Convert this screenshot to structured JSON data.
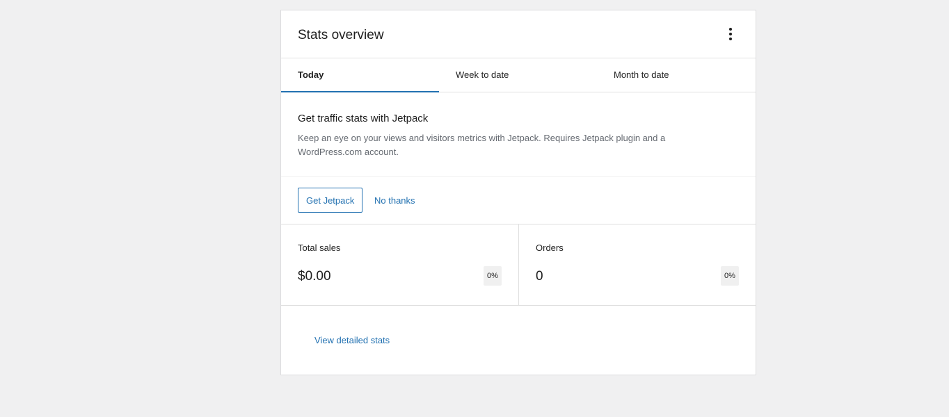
{
  "card": {
    "title": "Stats overview",
    "menu_icon": "more-vertical-icon"
  },
  "tabs": [
    {
      "label": "Today",
      "active": true
    },
    {
      "label": "Week to date",
      "active": false
    },
    {
      "label": "Month to date",
      "active": false
    }
  ],
  "promo": {
    "title": "Get traffic stats with Jetpack",
    "description": "Keep an eye on your views and visitors metrics with Jetpack. Requires Jetpack plugin and a WordPress.com account.",
    "primary_label": "Get Jetpack",
    "secondary_label": "No thanks"
  },
  "stats": [
    {
      "label": "Total sales",
      "value": "$0.00",
      "delta": "0%"
    },
    {
      "label": "Orders",
      "value": "0",
      "delta": "0%"
    }
  ],
  "footer": {
    "link_label": "View detailed stats"
  },
  "colors": {
    "accent": "#2271b1",
    "background": "#f0f0f1",
    "card": "#ffffff",
    "muted_text": "#646970"
  }
}
